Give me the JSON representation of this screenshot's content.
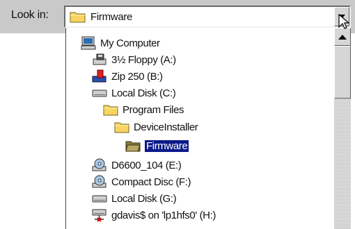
{
  "look_in": {
    "label": "Look in:",
    "current_folder": "Firmware",
    "folder_icon": "folder-icon",
    "dropdown_arrow_icon": "chevron-down-icon"
  },
  "tree_items": [
    {
      "label": "My Computer",
      "icon": "computer-icon",
      "depth": 0,
      "selected": false
    },
    {
      "label": "3½ Floppy (A:)",
      "icon": "floppy-drive-icon",
      "depth": 1,
      "selected": false
    },
    {
      "label": "Zip 250  (B:)",
      "icon": "zip-drive-icon",
      "depth": 1,
      "selected": false
    },
    {
      "label": "Local Disk (C:)",
      "icon": "hard-disk-icon",
      "depth": 1,
      "selected": false
    },
    {
      "label": "Program Files",
      "icon": "folder-icon",
      "depth": 2,
      "selected": false
    },
    {
      "label": "DeviceInstaller",
      "icon": "folder-icon",
      "depth": 3,
      "selected": false
    },
    {
      "label": "Firmware",
      "icon": "folder-open-icon",
      "depth": 4,
      "selected": true
    },
    {
      "label": "D6600_104 (E:)",
      "icon": "cd-drive-icon",
      "depth": 1,
      "selected": false
    },
    {
      "label": "Compact Disc (F:)",
      "icon": "cd-drive-icon",
      "depth": 1,
      "selected": false
    },
    {
      "label": "Local Disk (G:)",
      "icon": "hard-disk-icon",
      "depth": 1,
      "selected": false
    },
    {
      "label": "gdavis$ on 'lp1hfs0' (H:)",
      "icon": "network-drive-icon",
      "depth": 1,
      "selected": false
    }
  ],
  "colors": {
    "selection_background": "#0a1a8a",
    "selection_text": "#ffffff",
    "folder_yellow": "#f7d560",
    "toolbar_gray": "#c9c9c9"
  }
}
